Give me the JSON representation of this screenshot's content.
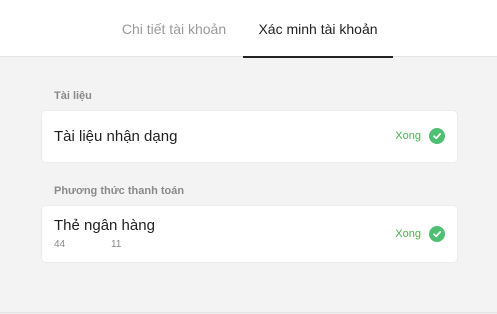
{
  "tabs": {
    "details_label": "Chi tiết tài khoản",
    "verify_label": "Xác minh tài khoản"
  },
  "sections": {
    "documents": {
      "label": "Tài liệu",
      "item": {
        "title": "Tài liệu nhận dạng",
        "status": "Xong",
        "status_icon": "check-circle-icon"
      }
    },
    "payment": {
      "label": "Phương thức thanh toán",
      "item": {
        "title": "Thẻ ngân hàng",
        "card_prefix": "44",
        "card_suffix": "11",
        "status": "Xong",
        "status_icon": "check-circle-icon"
      }
    }
  },
  "colors": {
    "success": "#4fbf72",
    "active_tab": "#222222",
    "inactive_tab": "#9a9a9a"
  }
}
